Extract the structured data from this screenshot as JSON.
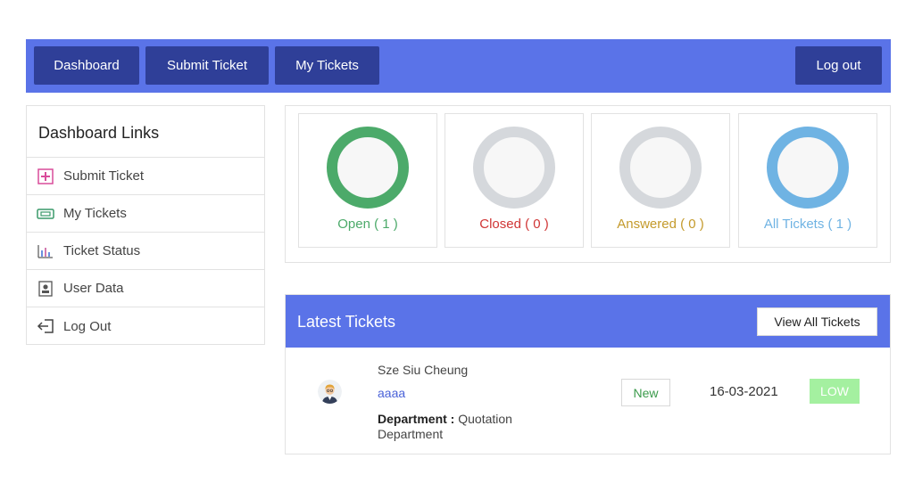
{
  "nav": {
    "dashboard": "Dashboard",
    "submit_ticket": "Submit Ticket",
    "my_tickets": "My Tickets",
    "logout": "Log out"
  },
  "sidebar": {
    "title": "Dashboard Links",
    "items": [
      {
        "label": "Submit Ticket",
        "icon": "plus-square-icon"
      },
      {
        "label": "My Tickets",
        "icon": "ticket-icon"
      },
      {
        "label": "Ticket Status",
        "icon": "bar-chart-icon"
      },
      {
        "label": "User Data",
        "icon": "id-card-icon"
      },
      {
        "label": "Log Out",
        "icon": "logout-icon"
      }
    ]
  },
  "stats": [
    {
      "label": "Open ( 1 )",
      "color": "#4caa6a"
    },
    {
      "label": "Closed ( 0 )",
      "color": "#d03535"
    },
    {
      "label": "Answered ( 0 )",
      "color": "#c49a2b"
    },
    {
      "label": "All Tickets ( 1 )",
      "color": "#6fb3e3"
    }
  ],
  "latest": {
    "title": "Latest Tickets",
    "view_all": "View All Tickets",
    "ticket": {
      "user": "Sze Siu Cheung",
      "subject": "aaaa",
      "department_label": "Department :",
      "department": "Quotation Department",
      "status": "New",
      "date": "16-03-2021",
      "priority": "LOW"
    }
  },
  "colors": {
    "nav_bg": "#5a73e8",
    "nav_button": "#2f3f98",
    "open_ring": "#4caa6a",
    "empty_ring": "#d5d8dc",
    "all_ring": "#6fb3e3",
    "priority_low": "#a4f0a0"
  }
}
